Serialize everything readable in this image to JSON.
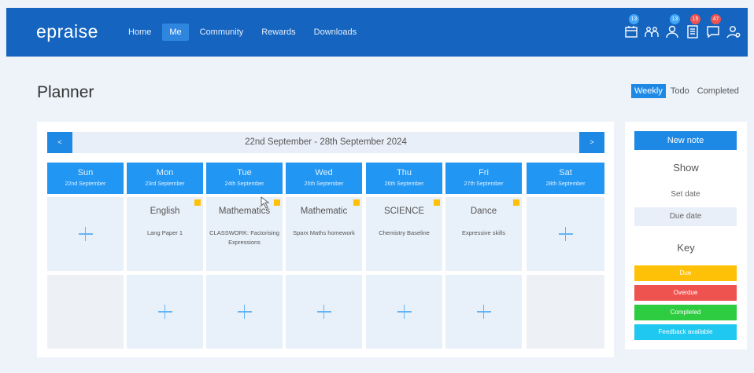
{
  "header": {
    "logo": "epraise",
    "nav": [
      {
        "label": "Home",
        "active": false
      },
      {
        "label": "Me",
        "active": true
      },
      {
        "label": "Community",
        "active": false
      },
      {
        "label": "Rewards",
        "active": false
      },
      {
        "label": "Downloads",
        "active": false
      }
    ],
    "icons": [
      {
        "name": "calendar-icon",
        "badge": "13",
        "badge_color": "blue"
      },
      {
        "name": "group-icon",
        "badge": "",
        "badge_color": ""
      },
      {
        "name": "user-icon",
        "badge": "13",
        "badge_color": "blue"
      },
      {
        "name": "planner-icon",
        "badge": "15",
        "badge_color": "red"
      },
      {
        "name": "messages-icon",
        "badge": "47",
        "badge_color": "red"
      },
      {
        "name": "account-icon",
        "badge": "",
        "badge_color": ""
      }
    ]
  },
  "page": {
    "title": "Planner"
  },
  "view_tabs": [
    {
      "label": "Weekly",
      "active": true
    },
    {
      "label": "Todo",
      "active": false
    },
    {
      "label": "Completed",
      "active": false
    }
  ],
  "planner": {
    "prev_label": "<",
    "next_label": ">",
    "week_label": "22nd September - 28th September 2024",
    "days": [
      {
        "name": "Sun",
        "date": "22nd September"
      },
      {
        "name": "Mon",
        "date": "23rd September"
      },
      {
        "name": "Tue",
        "date": "24th September"
      },
      {
        "name": "Wed",
        "date": "25th September"
      },
      {
        "name": "Thu",
        "date": "26th September"
      },
      {
        "name": "Fri",
        "date": "27th September"
      },
      {
        "name": "Sat",
        "date": "28th September"
      }
    ],
    "tasks": [
      null,
      {
        "subject": "English",
        "description": "Lang Paper 1"
      },
      {
        "subject": "Mathematics",
        "description": "CLASSWORK: Factorising Expressions"
      },
      {
        "subject": "Mathematic",
        "description": "Sparx Maths homework"
      },
      {
        "subject": "SCIENCE",
        "description": "Chemistry Baseline"
      },
      {
        "subject": "Dance",
        "description": "Expressive skills"
      },
      null
    ]
  },
  "side_panel": {
    "new_note": "New note",
    "show_heading": "Show",
    "set_date": "Set date",
    "due_date": "Due date",
    "key_heading": "Key",
    "key_items": [
      {
        "label": "Due",
        "color": "#ffc107"
      },
      {
        "label": "Overdue",
        "color": "#ef5350"
      },
      {
        "label": "Completed",
        "color": "#2ecc40"
      },
      {
        "label": "Feedback available",
        "color": "#1ec8f0"
      }
    ]
  },
  "colors": {
    "header_bg": "#1565c0",
    "accent": "#1e88e5",
    "day_header": "#2196f3",
    "due_marker": "#ffc107"
  }
}
